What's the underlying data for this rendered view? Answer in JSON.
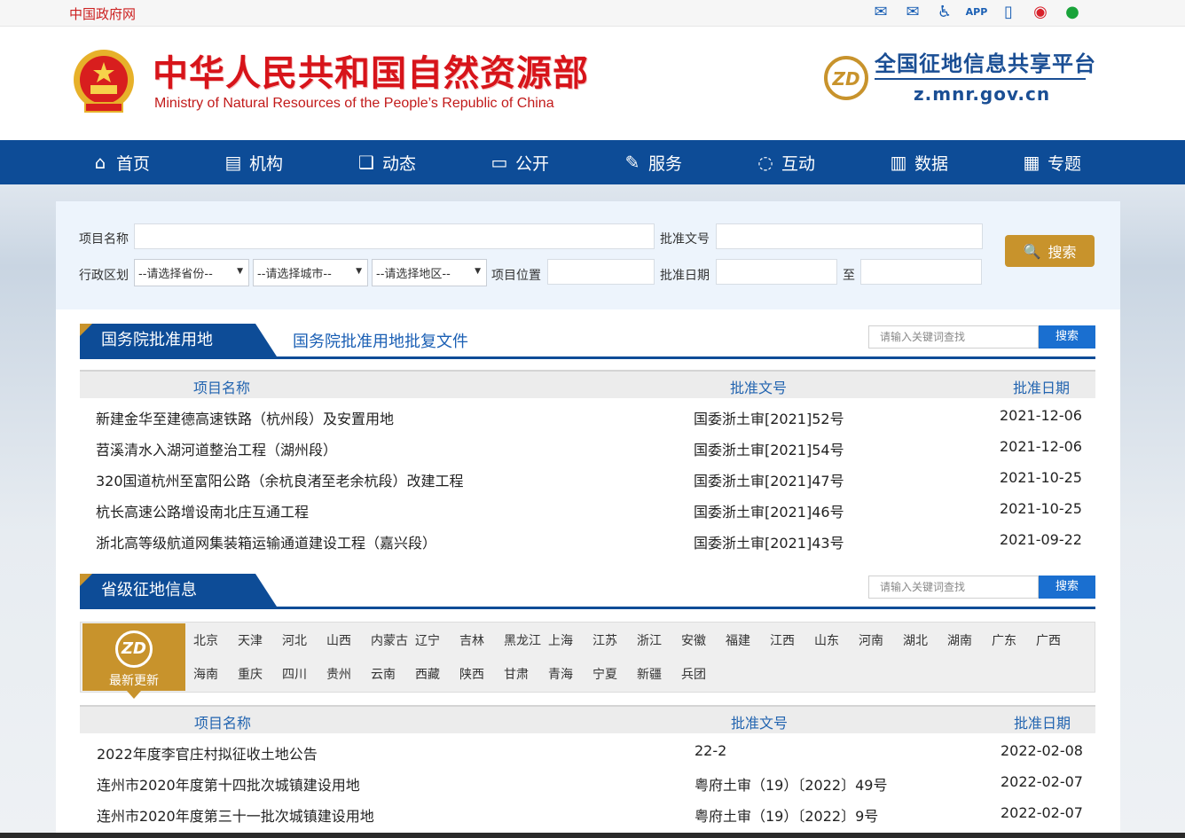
{
  "topbar": {
    "gov_link": "中国政府网",
    "icons": [
      "mail-icon",
      "mail-add-icon",
      "accessibility-icon",
      "app-icon",
      "mobile-icon",
      "weibo-icon",
      "wechat-icon"
    ]
  },
  "header": {
    "org_cn": "中华人民共和国自然资源部",
    "org_en": "Ministry of Natural Resources of the People’s Republic of China",
    "platform_cn": "全国征地信息共享平台",
    "platform_url": "z.mnr.gov.cn",
    "zd_logo_text": "ZD"
  },
  "nav": [
    {
      "label": "首页",
      "icon": "home-icon"
    },
    {
      "label": "机构",
      "icon": "org-icon"
    },
    {
      "label": "动态",
      "icon": "book-icon"
    },
    {
      "label": "公开",
      "icon": "monitor-icon"
    },
    {
      "label": "服务",
      "icon": "form-icon"
    },
    {
      "label": "互动",
      "icon": "chat-icon"
    },
    {
      "label": "数据",
      "icon": "chart-icon"
    },
    {
      "label": "专题",
      "icon": "document-icon"
    }
  ],
  "search": {
    "project_name_label": "项目名称",
    "approval_no_label": "批准文号",
    "region_label": "行政区划",
    "province_select": "--请选择省份--",
    "city_select": "--请选择城市--",
    "district_select": "--请选择地区--",
    "location_label": "项目位置",
    "approval_date_label": "批准日期",
    "to_label": "至",
    "button": "搜索"
  },
  "state_council": {
    "tab": "国务院批准用地",
    "subtitle": "国务院批准用地批复文件",
    "search_placeholder": "请输入关键词查找",
    "search_button": "搜索",
    "columns": [
      "项目名称",
      "批准文号",
      "批准日期"
    ],
    "rows": [
      {
        "name": "新建金华至建德高速铁路（杭州段）及安置用地",
        "no": "国委浙土审[2021]52号",
        "date": "2021-12-06"
      },
      {
        "name": "苕溪清水入湖河道整治工程（湖州段）",
        "no": "国委浙土审[2021]54号",
        "date": "2021-12-06"
      },
      {
        "name": "320国道杭州至富阳公路（余杭良渚至老余杭段）改建工程",
        "no": "国委浙土审[2021]47号",
        "date": "2021-10-25"
      },
      {
        "name": "杭长高速公路增设南北庄互通工程",
        "no": "国委浙土审[2021]46号",
        "date": "2021-10-25"
      },
      {
        "name": "浙北高等级航道网集装箱运输通道建设工程（嘉兴段）",
        "no": "国委浙土审[2021]43号",
        "date": "2021-09-22"
      }
    ]
  },
  "provincial": {
    "tab": "省级征地信息",
    "search_placeholder": "请输入关键词查找",
    "search_button": "搜索",
    "badge_text": "ZD",
    "badge_label": "最新更新",
    "provinces_row1": [
      "北京",
      "天津",
      "河北",
      "山西",
      "内蒙古",
      "辽宁",
      "吉林",
      "黑龙江",
      "上海",
      "江苏",
      "浙江",
      "安徽",
      "福建",
      "江西",
      "山东",
      "河南",
      "湖北",
      "湖南",
      "广东",
      "广西"
    ],
    "provinces_row2": [
      "海南",
      "重庆",
      "四川",
      "贵州",
      "云南",
      "西藏",
      "陕西",
      "甘肃",
      "青海",
      "宁夏",
      "新疆",
      "兵团"
    ],
    "columns": [
      "项目名称",
      "批准文号",
      "批准日期"
    ],
    "rows": [
      {
        "name": "2022年度李官庄村拟征收土地公告",
        "no": "22-2",
        "date": "2022-02-08"
      },
      {
        "name": "连州市2020年度第十四批次城镇建设用地",
        "no": "粤府土审（19）〔2022〕49号",
        "date": "2022-02-07"
      },
      {
        "name": "连州市2020年度第三十一批次城镇建设用地",
        "no": "粤府土审（19）〔2022〕9号",
        "date": "2022-02-07"
      }
    ]
  }
}
